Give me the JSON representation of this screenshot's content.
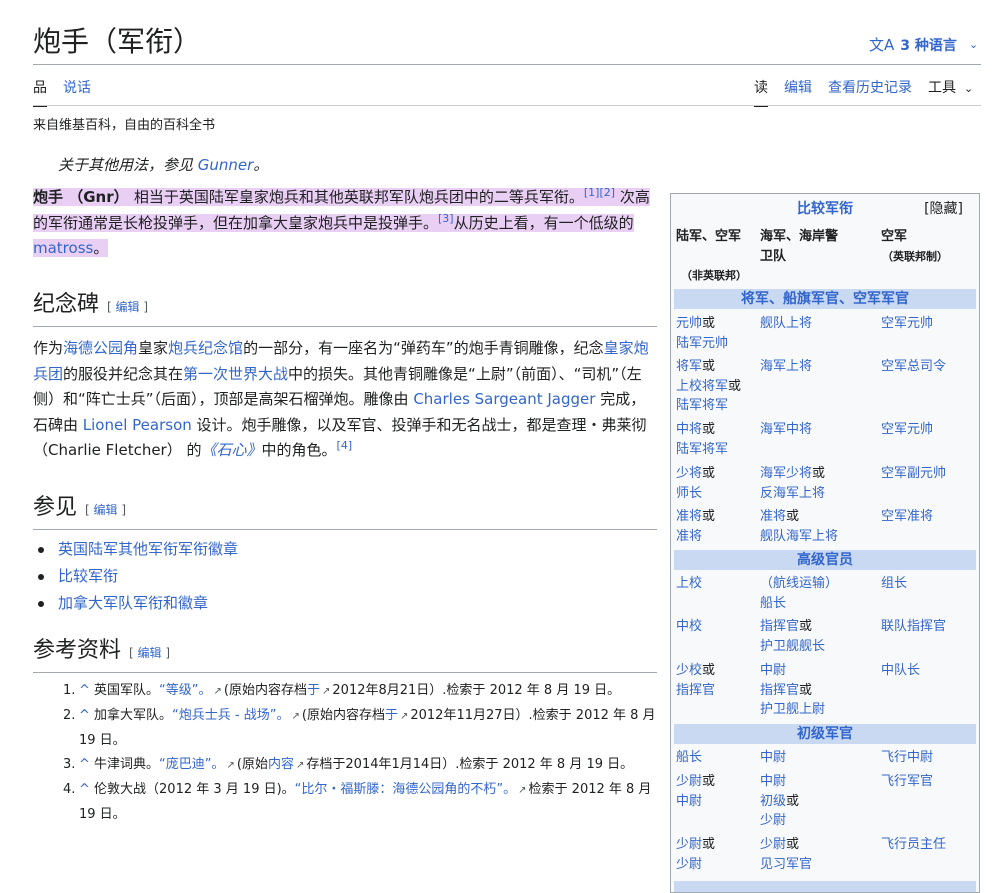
{
  "header": {
    "title": "炮手（军衔）",
    "languages": "3 种语言",
    "tabs_left": [
      "品",
      "说话"
    ],
    "tabs_right": [
      "读",
      "编辑",
      "查看历史记录",
      "工具"
    ],
    "tagline": "来自维基百科，自由的百科全书"
  },
  "hatnote": {
    "prefix": "关于其他用法，参见 ",
    "link": "Gunner",
    "suffix": "。"
  },
  "intro": {
    "t1": "炮手 （Gnr） ",
    "t2": "相当于英国陆军皇家炮兵和其他英联邦军队炮兵团中的二等兵军衔。",
    "r1": "[1]",
    "r2": "[2]",
    "t3": "次高的军衔通常是长枪投弹手，但在加拿大皇家炮兵中是投弹手。",
    "r3": "[3]",
    "t4": "从历史上看，有一个低级的 ",
    "link": "matross",
    "t5": "。"
  },
  "memorial": {
    "heading": "纪念碑",
    "edit": "编辑",
    "p1": "作为",
    "l1": "海德公园角",
    "p2": "皇家",
    "l2": "炮兵纪念馆",
    "p3": "的一部分，有一座名为“弹药车”的炮手青铜雕像，纪念",
    "l3": "皇家炮兵团",
    "p4": "的服役并纪念其在",
    "l4": "第一次世界大战",
    "p5": "中的损失。其他青铜雕像是“上尉”（前面）、“司机”（左侧）和“阵亡士兵”（后面），顶部是高架石榴弹炮。雕像由 ",
    "l5": "Charles Sargeant Jagger",
    "p6": " 完成，石碑由 ",
    "l6": "Lionel Pearson",
    "p7": " 设计。炮手雕像，以及军官、投弹手和无名战士，都是查理・弗莱彻 （Charlie Fletcher） 的",
    "l7": "《石心》",
    "p8": "中的角色。",
    "r4": "[4]"
  },
  "see_also": {
    "heading": "参见",
    "edit": "编辑",
    "items": [
      "英国陆军其他军衔军衔徽章",
      "比较军衔",
      "加拿大军队军衔和徽章"
    ]
  },
  "references": {
    "heading": "参考资料",
    "edit": "编辑",
    "r1": {
      "num": "1.",
      "caret": "^",
      "a": " 英国军队。",
      "link": "“等级”。",
      "b": "(原始内容存档",
      "link2": "于",
      "c": "2012年8月21日）.检索于 2012 年 8 月 19 日。"
    },
    "r2": {
      "num": "2.",
      "caret": "^",
      "a": " 加拿大军队。",
      "link": "“炮兵士兵 - 战场”。",
      "b": "(原始内容存档",
      "link2": "于",
      "c": "2012年11月27日）.检索于 2012 年 8 月 19 日。"
    },
    "r3": {
      "num": "3.",
      "caret": "^",
      "a": " 牛津词典。",
      "link": "“庞巴迪”。",
      "b": "(原始",
      "link2": "内容",
      "c": "存档于2014年1月14日）.检索于 2012 年 8 月 19 日。"
    },
    "r4": {
      "num": "4.",
      "caret": "^",
      "a": " 伦敦大战（2012 年 3 月 19 日)。",
      "link": "“比尔・福斯滕：海德公园角的不朽”。",
      "c": "检索于 2012 年 8 月 19 日。"
    }
  },
  "infobox": {
    "caption": "比较军衔",
    "hide": "[隐藏]",
    "col_army": "陆军、空军",
    "col_army_note": "（非英联邦）",
    "col_navy": "海军、海岸警卫队",
    "col_af": "空军",
    "col_af_note": "（英联邦制）",
    "sect1": "将军、船旗军官、空军军官",
    "sect2": "高级官员",
    "sect3": "初级军官",
    "rows": {
      "g1": {
        "a1": "元帅",
        "o1": "或",
        "a2": "陆军元帅",
        "n": "舰队上将",
        "f": "空军元帅"
      },
      "g2": {
        "a1": "将军",
        "o1": "或",
        "a2": "上校将军",
        "o2": "或",
        "a3": "陆军将军",
        "n": "海军上将",
        "f": "空军总司令"
      },
      "g3": {
        "a1": "中将",
        "o1": "或",
        "a2": "陆军将军",
        "n": "海军中将",
        "f": "空军元帅"
      },
      "g4": {
        "a1": "少将",
        "o1": "或",
        "a2": "师长",
        "n1": "海军少将",
        "no": "或",
        "n2": "反海军上将",
        "f": "空军副元帅"
      },
      "g5": {
        "a1": "准将",
        "o1": "或",
        "a2": "准将",
        "n1": "准将",
        "no": "或",
        "n2": "舰队海军上将",
        "f": "空军准将"
      },
      "s1": {
        "a": "上校",
        "n1": "（航线运输）",
        "n2": "船长",
        "f": "组长"
      },
      "s2": {
        "a": "中校",
        "n1": "指挥官",
        "no": "或",
        "n2": "护卫舰舰长",
        "f": "联队指挥官"
      },
      "s3": {
        "a1": "少校",
        "o1": "或",
        "a2": "指挥官",
        "n1": "中尉",
        "n2": "指挥官",
        "no": "或",
        "n3": "护卫舰上尉",
        "f": "中队长"
      },
      "j1": {
        "a": "船长",
        "n": "中尉",
        "f": "飞行中尉"
      },
      "j2": {
        "a1": "少尉",
        "o1": "或",
        "a2": "中尉",
        "n1": "中尉",
        "n2": "初级",
        "no": "或",
        "n3": "少尉",
        "f": "飞行军官"
      },
      "j3": {
        "a1": "少尉",
        "o1": "或",
        "a2": "少尉",
        "n1": "少尉",
        "no": "或",
        "n2": "见习军官",
        "f": "飞行员主任"
      }
    }
  }
}
